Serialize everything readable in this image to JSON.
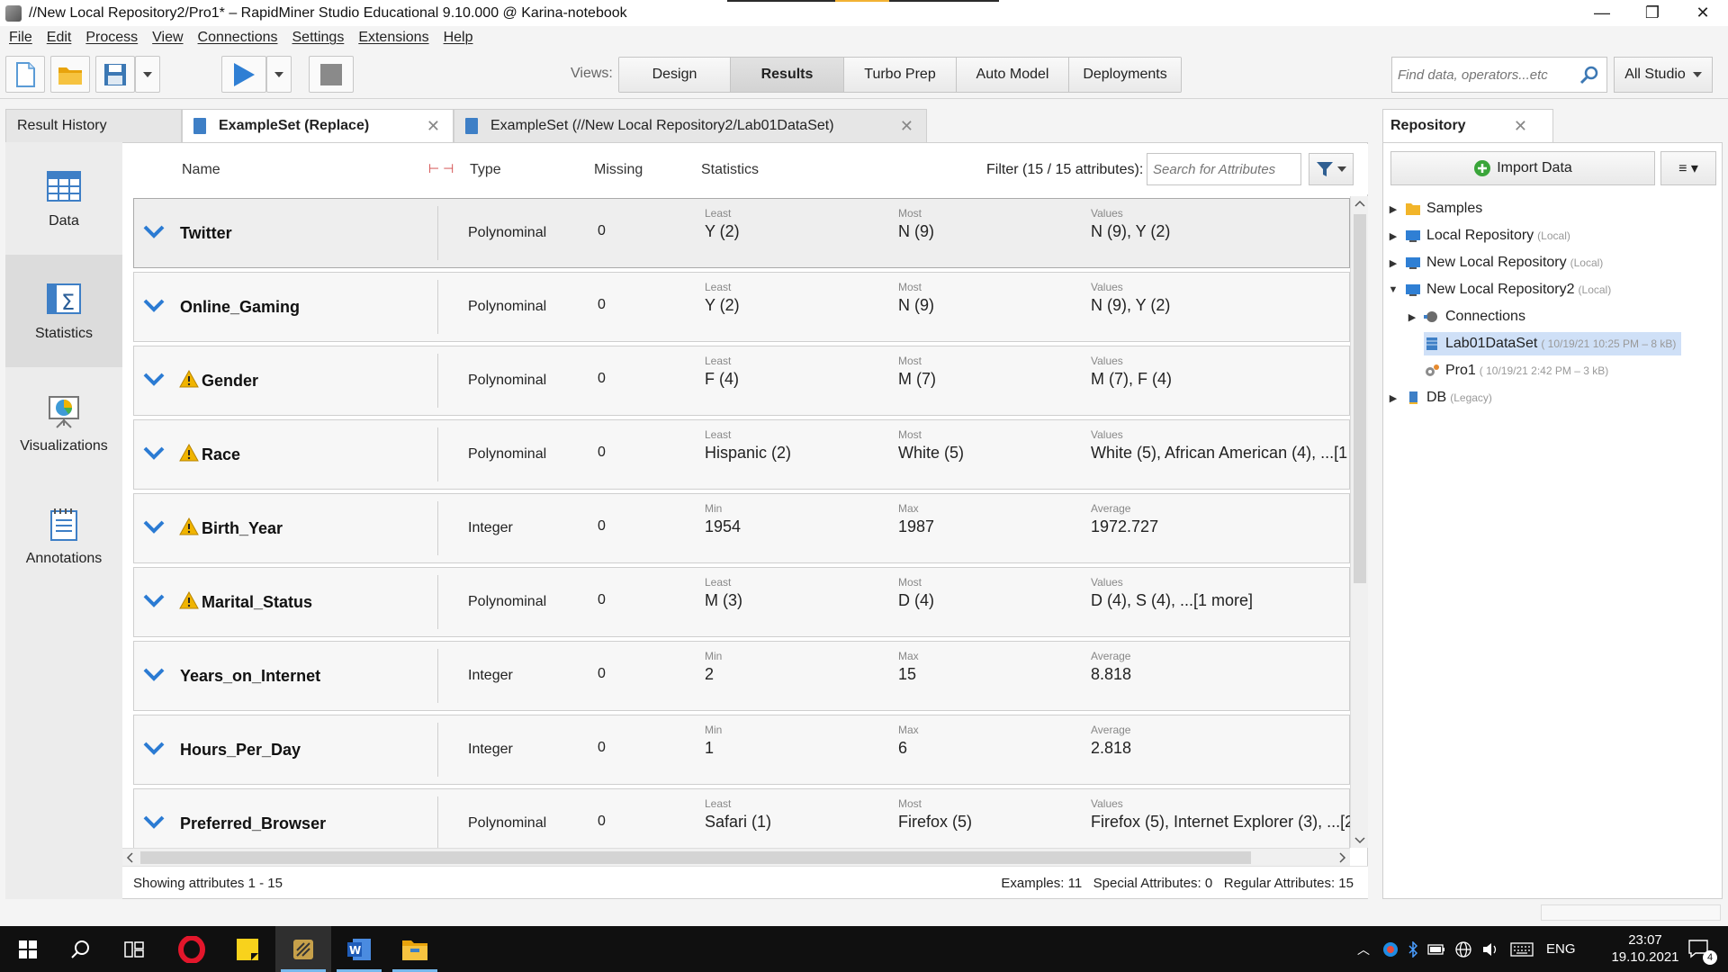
{
  "window": {
    "title": "//New Local Repository2/Pro1* – RapidMiner Studio Educational 9.10.000 @ Karina-notebook",
    "controls": [
      "—",
      "❐",
      "✕"
    ]
  },
  "menu": [
    "File",
    "Edit",
    "Process",
    "View",
    "Connections",
    "Settings",
    "Extensions",
    "Help"
  ],
  "toolbar": {
    "views_label": "Views:",
    "views": [
      "Design",
      "Results",
      "Turbo Prep",
      "Auto Model",
      "Deployments"
    ],
    "active_view": "Results",
    "search_placeholder": "Find data, operators...etc",
    "scope_label": "All Studio"
  },
  "tabs": {
    "result_history": "Result History",
    "tab1": "ExampleSet (Replace)",
    "tab2": "ExampleSet (//New Local Repository2/Lab01DataSet)"
  },
  "side_nav": [
    "Data",
    "Statistics",
    "Visualizations",
    "Annotations"
  ],
  "stats": {
    "headers": {
      "name": "Name",
      "type": "Type",
      "missing": "Missing",
      "statistics": "Statistics"
    },
    "filter_label": "Filter (15 / 15 attributes):",
    "search_placeholder": "Search for Attributes",
    "rows": [
      {
        "name": "Twitter",
        "warn": false,
        "type": "Polynominal",
        "missing": "0",
        "l1": "Least",
        "v1": "Y (2)",
        "l2": "Most",
        "v2": "N (9)",
        "l3": "Values",
        "v3": "N (9), Y (2)"
      },
      {
        "name": "Online_Gaming",
        "warn": false,
        "type": "Polynominal",
        "missing": "0",
        "l1": "Least",
        "v1": "Y (2)",
        "l2": "Most",
        "v2": "N (9)",
        "l3": "Values",
        "v3": "N (9), Y (2)"
      },
      {
        "name": "Gender",
        "warn": true,
        "type": "Polynominal",
        "missing": "0",
        "l1": "Least",
        "v1": "F (4)",
        "l2": "Most",
        "v2": "M (7)",
        "l3": "Values",
        "v3": "M (7), F (4)"
      },
      {
        "name": "Race",
        "warn": true,
        "type": "Polynominal",
        "missing": "0",
        "l1": "Least",
        "v1": "Hispanic (2)",
        "l2": "Most",
        "v2": "White (5)",
        "l3": "Values",
        "v3": "White (5), African American (4), ...[1"
      },
      {
        "name": "Birth_Year",
        "warn": true,
        "type": "Integer",
        "missing": "0",
        "l1": "Min",
        "v1": "1954",
        "l2": "Max",
        "v2": "1987",
        "l3": "Average",
        "v3": "1972.727"
      },
      {
        "name": "Marital_Status",
        "warn": true,
        "type": "Polynominal",
        "missing": "0",
        "l1": "Least",
        "v1": "M (3)",
        "l2": "Most",
        "v2": "D (4)",
        "l3": "Values",
        "v3": "D (4), S (4), ...[1 more]"
      },
      {
        "name": "Years_on_Internet",
        "warn": false,
        "type": "Integer",
        "missing": "0",
        "l1": "Min",
        "v1": "2",
        "l2": "Max",
        "v2": "15",
        "l3": "Average",
        "v3": "8.818"
      },
      {
        "name": "Hours_Per_Day",
        "warn": false,
        "type": "Integer",
        "missing": "0",
        "l1": "Min",
        "v1": "1",
        "l2": "Max",
        "v2": "6",
        "l3": "Average",
        "v3": "2.818"
      },
      {
        "name": "Preferred_Browser",
        "warn": false,
        "type": "Polynominal",
        "missing": "0",
        "l1": "Least",
        "v1": "Safari (1)",
        "l2": "Most",
        "v2": "Firefox (5)",
        "l3": "Values",
        "v3": "Firefox (5), Internet Explorer (3), ...[2"
      }
    ],
    "status_left": "Showing attributes 1 - 15",
    "status_right": "Examples: 11   Special Attributes: 0   Regular Attributes: 15"
  },
  "repository": {
    "title": "Repository",
    "import_label": "Import Data",
    "menu_label": "≡ ▾",
    "tree": [
      {
        "label": "Samples",
        "suffix": "",
        "expand": "▶",
        "icon": "folder-icon"
      },
      {
        "label": "Local Repository",
        "suffix": "(Local)",
        "expand": "▶",
        "icon": "repository-icon"
      },
      {
        "label": "New Local Repository",
        "suffix": "(Local)",
        "expand": "▶",
        "icon": "repository-icon"
      },
      {
        "label": "New Local Repository2",
        "suffix": "(Local)",
        "expand": "▼",
        "icon": "repository-icon"
      },
      {
        "label": "Connections",
        "suffix": "",
        "expand": "▶",
        "icon": "connections-icon"
      },
      {
        "label": "Lab01DataSet",
        "suffix": "( 10/19/21 10:25 PM – 8 kB)",
        "expand": "",
        "icon": "dataset-icon"
      },
      {
        "label": "Pro1",
        "suffix": "( 10/19/21 2:42 PM – 3 kB)",
        "expand": "",
        "icon": "process-icon"
      },
      {
        "label": "DB",
        "suffix": "(Legacy)",
        "expand": "▶",
        "icon": "database-icon"
      }
    ]
  },
  "taskbar": {
    "lang": "ENG",
    "time": "23:07",
    "date": "19.10.2021",
    "notifications": "4"
  },
  "colors": {
    "accent": "#3e7fc6",
    "chevron": "#2b7bd3",
    "warning": "#f0b400"
  }
}
